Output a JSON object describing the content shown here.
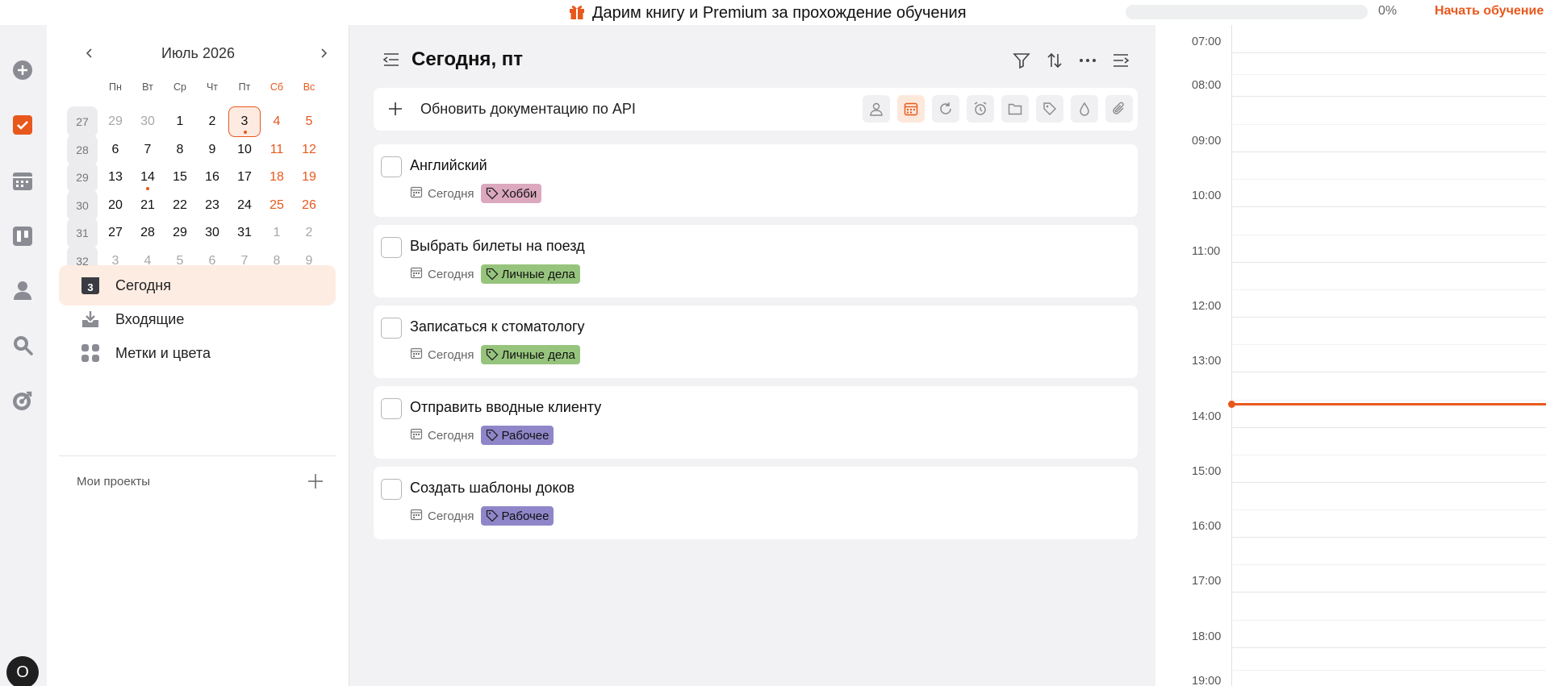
{
  "banner": {
    "text": "Дарим книгу и Premium за прохождение обучения",
    "progress_percent": 0,
    "progress_label": "0%",
    "start_label": "Начать обучение"
  },
  "colors": {
    "accent": "#e8581d",
    "tag_hobby": "#dba8bd",
    "tag_personal": "#97c47d",
    "tag_work": "#8f86c9"
  },
  "rail": {
    "icons": [
      "add-circle-icon",
      "checkbox-icon",
      "calendar-grid-icon",
      "kanban-icon",
      "person-icon",
      "search-icon",
      "target-icon"
    ],
    "avatar_letter": "О"
  },
  "calendar": {
    "title": "Июль 2026",
    "weekdays": [
      "Пн",
      "Вт",
      "Ср",
      "Чт",
      "Пт",
      "Сб",
      "Вс"
    ],
    "weeks": [
      {
        "num": "27",
        "days": [
          "29",
          "30",
          "1",
          "2",
          "3",
          "4",
          "5"
        ]
      },
      {
        "num": "28",
        "days": [
          "6",
          "7",
          "8",
          "9",
          "10",
          "11",
          "12"
        ]
      },
      {
        "num": "29",
        "days": [
          "13",
          "14",
          "15",
          "16",
          "17",
          "18",
          "19"
        ]
      },
      {
        "num": "30",
        "days": [
          "20",
          "21",
          "22",
          "23",
          "24",
          "25",
          "26"
        ]
      },
      {
        "num": "31",
        "days": [
          "27",
          "28",
          "29",
          "30",
          "31",
          "1",
          "2"
        ]
      },
      {
        "num": "32",
        "days": [
          "3",
          "4",
          "5",
          "6",
          "7",
          "8",
          "9"
        ]
      }
    ],
    "today": "3",
    "days_with_dot": [
      "3",
      "14"
    ]
  },
  "sidebar": {
    "items": [
      {
        "label": "Сегодня",
        "icon": "calendar-today-icon",
        "badge": "3"
      },
      {
        "label": "Входящие",
        "icon": "inbox-icon"
      },
      {
        "label": "Метки и цвета",
        "icon": "grid-dots-icon"
      }
    ],
    "projects_label": "Мои проекты"
  },
  "main": {
    "title": "Сегодня, пт",
    "add_input_value": "Обновить документацию по API",
    "add_tools": [
      "assignee-icon",
      "calendar-icon",
      "repeat-icon",
      "alarm-icon",
      "folder-icon",
      "tag-icon",
      "color-drop-icon",
      "attachment-icon"
    ],
    "tasks": [
      {
        "title": "Английский",
        "date": "Сегодня",
        "tag": "Хобби",
        "tag_color": "#dba8bd"
      },
      {
        "title": "Выбрать билеты на поезд",
        "date": "Сегодня",
        "tag": "Личные дела",
        "tag_color": "#97c47d"
      },
      {
        "title": "Записаться к стоматологу",
        "date": "Сегодня",
        "tag": "Личные дела",
        "tag_color": "#97c47d"
      },
      {
        "title": "Отправить вводные клиенту",
        "date": "Сегодня",
        "tag": "Рабочее",
        "tag_color": "#8f86c9"
      },
      {
        "title": "Создать шаблоны доков",
        "date": "Сегодня",
        "tag": "Рабочее",
        "tag_color": "#8f86c9"
      }
    ]
  },
  "timeline": {
    "hours": [
      "07:00",
      "08:00",
      "09:00",
      "10:00",
      "11:00",
      "12:00",
      "13:00",
      "14:00",
      "15:00",
      "16:00",
      "17:00",
      "18:00",
      "19:00"
    ]
  }
}
